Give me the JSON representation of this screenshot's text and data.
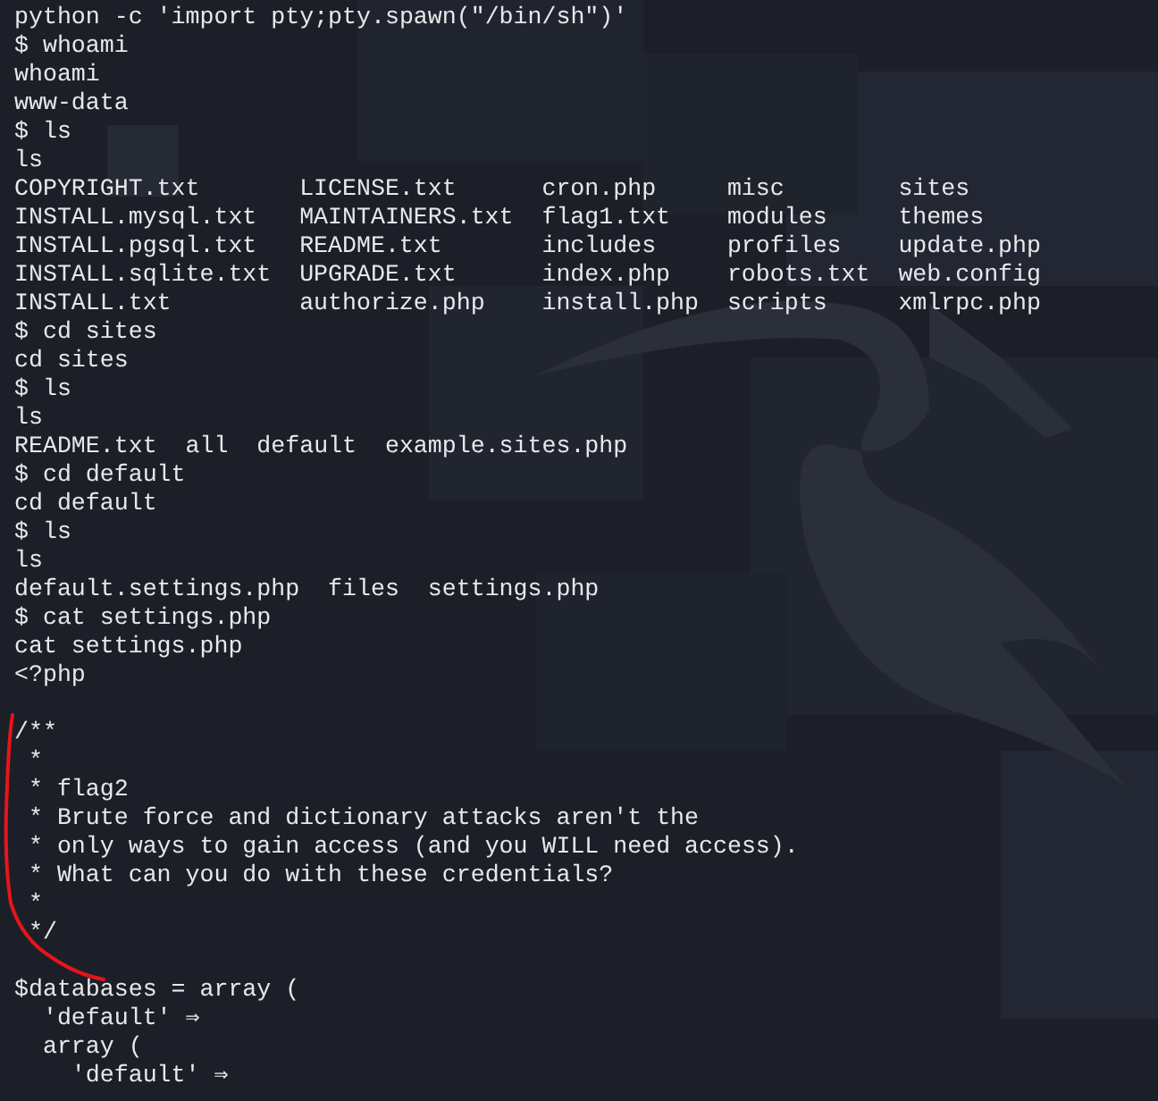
{
  "terminal": {
    "lines": [
      {
        "kind": "line",
        "text": "python -c 'import pty;pty.spawn(\"/bin/sh\")'"
      },
      {
        "kind": "line",
        "text": "$ whoami"
      },
      {
        "kind": "line",
        "text": "whoami"
      },
      {
        "kind": "line",
        "text": "www-data"
      },
      {
        "kind": "line",
        "text": "$ ls"
      },
      {
        "kind": "line",
        "text": "ls"
      },
      {
        "kind": "grid",
        "cells": [
          "COPYRIGHT.txt",
          "LICENSE.txt",
          "cron.php",
          "misc",
          "sites"
        ]
      },
      {
        "kind": "grid",
        "cells": [
          "INSTALL.mysql.txt",
          "MAINTAINERS.txt",
          "flag1.txt",
          "modules",
          "themes"
        ]
      },
      {
        "kind": "grid",
        "cells": [
          "INSTALL.pgsql.txt",
          "README.txt",
          "includes",
          "profiles",
          "update.php"
        ]
      },
      {
        "kind": "grid",
        "cells": [
          "INSTALL.sqlite.txt",
          "UPGRADE.txt",
          "index.php",
          "robots.txt",
          "web.config"
        ]
      },
      {
        "kind": "grid",
        "cells": [
          "INSTALL.txt",
          "authorize.php",
          "install.php",
          "scripts",
          "xmlrpc.php"
        ]
      },
      {
        "kind": "line",
        "text": "$ cd sites"
      },
      {
        "kind": "line",
        "text": "cd sites"
      },
      {
        "kind": "line",
        "text": "$ ls"
      },
      {
        "kind": "line",
        "text": "ls"
      },
      {
        "kind": "row",
        "cells": [
          "README.txt",
          "all",
          "default",
          "example.sites.php"
        ]
      },
      {
        "kind": "line",
        "text": "$ cd default"
      },
      {
        "kind": "line",
        "text": "cd default"
      },
      {
        "kind": "line",
        "text": "$ ls"
      },
      {
        "kind": "line",
        "text": "ls"
      },
      {
        "kind": "row",
        "cells": [
          "default.settings.php",
          "files",
          "settings.php"
        ]
      },
      {
        "kind": "line",
        "text": "$ cat settings.php"
      },
      {
        "kind": "line",
        "text": "cat settings.php"
      },
      {
        "kind": "line",
        "text": "<?php"
      },
      {
        "kind": "blank"
      },
      {
        "kind": "line",
        "text": "/**"
      },
      {
        "kind": "line",
        "text": " *"
      },
      {
        "kind": "line",
        "text": " * flag2"
      },
      {
        "kind": "line",
        "text": " * Brute force and dictionary attacks aren't the"
      },
      {
        "kind": "line",
        "text": " * only ways to gain access (and you WILL need access)."
      },
      {
        "kind": "line",
        "text": " * What can you do with these credentials?"
      },
      {
        "kind": "line",
        "text": " *"
      },
      {
        "kind": "line",
        "text": " */"
      },
      {
        "kind": "blank"
      },
      {
        "kind": "line",
        "text": "$databases = array ("
      },
      {
        "kind": "line",
        "text": "  'default' ⇒"
      },
      {
        "kind": "line",
        "text": "  array ("
      },
      {
        "kind": "line",
        "text": "    'default' ⇒"
      }
    ]
  }
}
